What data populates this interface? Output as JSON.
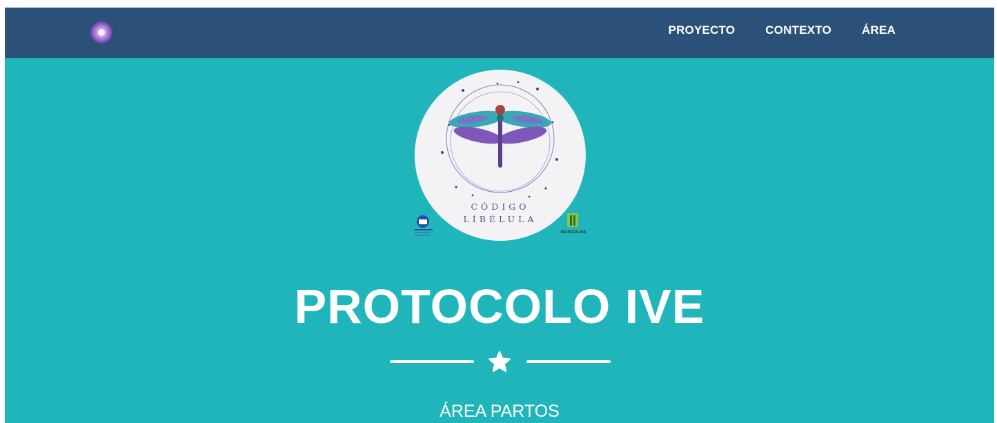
{
  "nav": {
    "items": [
      {
        "label": "PROYECTO"
      },
      {
        "label": "CONTEXTO"
      },
      {
        "label": "ÁREA"
      }
    ]
  },
  "logo": {
    "line1": "CÓDIGO",
    "line2": "LÍBÉLULA",
    "sponsor_right_caption": "MANIZALES"
  },
  "hero": {
    "title": "PROTOCOLO IVE",
    "subtitle": "ÁREA PARTOS"
  },
  "colors": {
    "navbar": "#2c5178",
    "hero": "#1fb5ba",
    "text": "#ffffff"
  }
}
